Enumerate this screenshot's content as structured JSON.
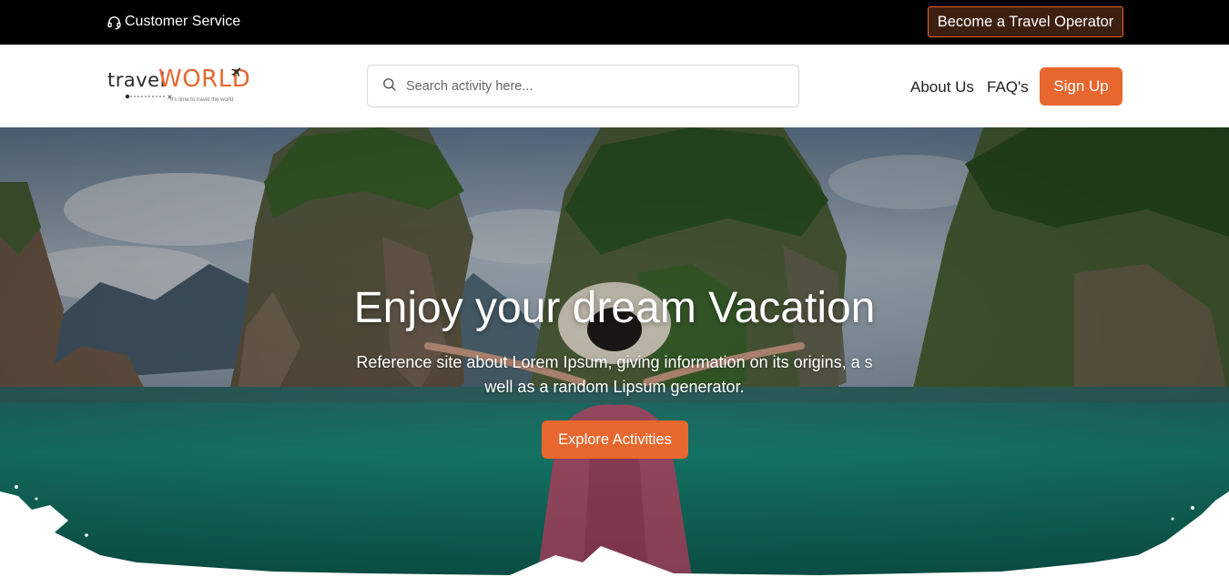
{
  "topbar": {
    "customer_service": "Customer Service",
    "operator_button": "Become a Travel Operator"
  },
  "header": {
    "logo": {
      "word1": "travel",
      "word2": "WORLD",
      "tagline": "It's time to travel the world"
    },
    "search": {
      "placeholder": "Search activity here...",
      "value": ""
    },
    "nav": {
      "about": "About Us",
      "faq": "FAQ's",
      "signup": "Sign Up"
    }
  },
  "hero": {
    "title": "Enjoy your dream Vacation",
    "subtitle": "Reference site about Lorem Ipsum, giving information on its origins, a s well as a random Lipsum generator.",
    "cta": "Explore Activities"
  },
  "colors": {
    "accent": "#e8672e",
    "topbar_bg": "#000000",
    "operator_btn_bg": "#3d1f10",
    "water": "#1f9a86",
    "sky": "#9fb4c8"
  },
  "icons": [
    "headset-icon",
    "search-icon",
    "airplane-icon"
  ]
}
